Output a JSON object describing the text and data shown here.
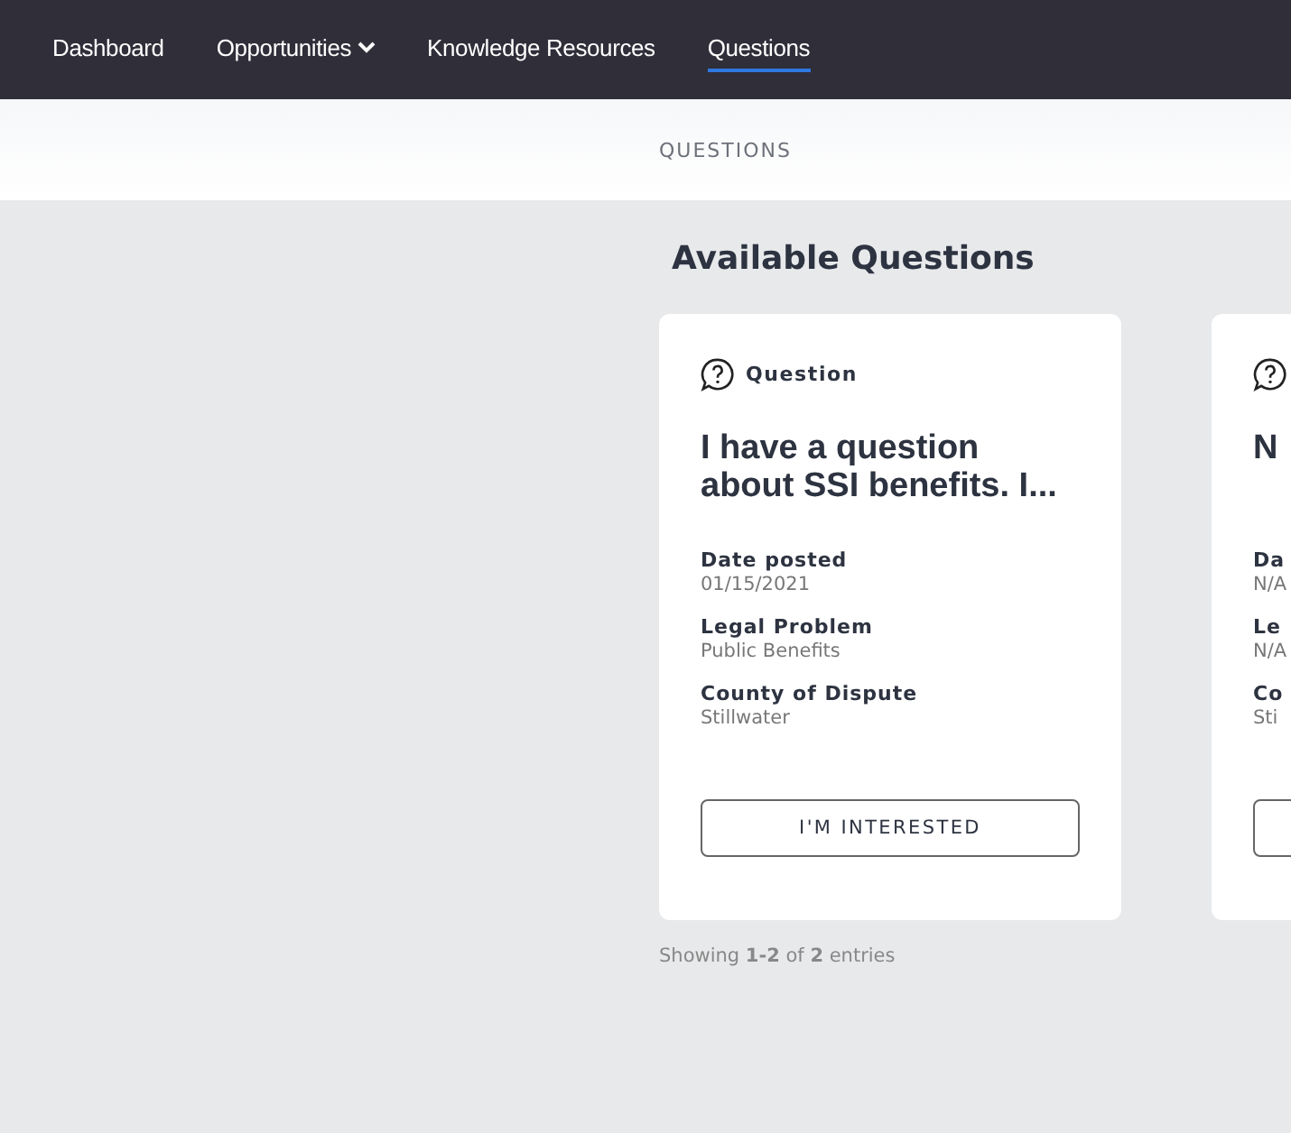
{
  "nav": [
    {
      "label": "Dashboard",
      "selected": false,
      "dropdown": false
    },
    {
      "label": "Opportunities",
      "selected": false,
      "dropdown": true
    },
    {
      "label": "Knowledge Resources",
      "selected": false,
      "dropdown": false
    },
    {
      "label": "Questions",
      "selected": true,
      "dropdown": false
    }
  ],
  "breadcrumb": "QUESTIONS",
  "heading": "Available Questions",
  "cards": [
    {
      "type_label": "Question",
      "title": "I have a question about SSI benefits. I...",
      "fields": [
        {
          "label": "Date posted",
          "value": "01/15/2021"
        },
        {
          "label": "Legal Problem",
          "value": "Public Benefits"
        },
        {
          "label": "County of Dispute",
          "value": "Stillwater"
        }
      ],
      "button": "I'M INTERESTED"
    },
    {
      "title": "N",
      "fields": [
        {
          "label": "Da",
          "value": "N/A"
        },
        {
          "label": "Le",
          "value": "N/A"
        },
        {
          "label": "Co",
          "value": "Sti"
        }
      ]
    }
  ],
  "footer": "Showing **1-2** of **2** entries"
}
